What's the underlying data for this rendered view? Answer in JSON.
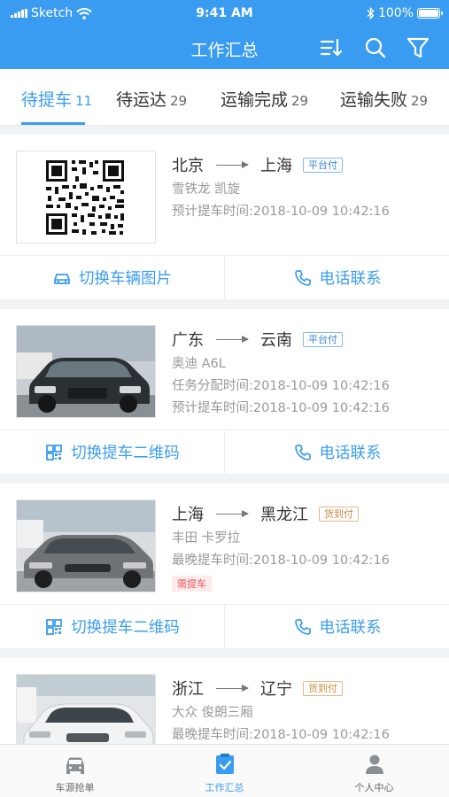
{
  "status_bar": {
    "carrier": "Sketch",
    "time": "9:41 AM",
    "battery": "100%"
  },
  "header": {
    "title": "工作汇总",
    "icons": [
      "sort-icon",
      "search-icon",
      "filter-icon"
    ]
  },
  "tabs": [
    {
      "label": "待提车",
      "count": "11",
      "active": true
    },
    {
      "label": "待运达",
      "count": "29",
      "active": false
    },
    {
      "label": "运输完成",
      "count": "29",
      "active": false
    },
    {
      "label": "运输失败",
      "count": "29",
      "active": false
    }
  ],
  "cards": [
    {
      "image": "qr-code",
      "from": "北京",
      "to": "上海",
      "pay": "平台付",
      "pay_type": "platform",
      "line1": "雪铁龙 凯旋",
      "line2": "预计提车时间:2018-10-09 10:42:16",
      "action_left": "切换车辆图片",
      "action_left_icon": "car-icon",
      "action_right": "电话联系"
    },
    {
      "image": "car-photo",
      "from": "广东",
      "to": "云南",
      "pay": "平台付",
      "pay_type": "platform",
      "line1": "奥迪 A6L",
      "line2": "任务分配时间:2018-10-09 10:42:16",
      "line3": "预计提车时间:2018-10-09 10:42:16",
      "action_left": "切换提车二维码",
      "action_left_icon": "qr-icon",
      "action_right": "电话联系"
    },
    {
      "image": "car-photo",
      "from": "上海",
      "to": "黑龙江",
      "pay": "货到付",
      "pay_type": "cod",
      "line1": "丰田 卡罗拉",
      "line2": "最晚提车时间:2018-10-09 10:42:16",
      "tag": "需提车",
      "action_left": "切换提车二维码",
      "action_left_icon": "qr-icon",
      "action_right": "电话联系"
    },
    {
      "image": "car-photo",
      "from": "浙江",
      "to": "辽宁",
      "pay": "货到付",
      "pay_type": "cod",
      "line1": "大众 俊朗三厢",
      "line2": "最晚提车时间:2018-10-09 10:42:16"
    }
  ],
  "bottom_nav": [
    {
      "label": "车源抢单",
      "icon": "car-front-icon",
      "active": false
    },
    {
      "label": "工作汇总",
      "icon": "checklist-icon",
      "active": true
    },
    {
      "label": "个人中心",
      "icon": "user-icon",
      "active": false
    }
  ],
  "colors": {
    "primary": "#3a9cf0",
    "background": "#f2f3f5",
    "cod": "#c98a3e",
    "alert": "#e05a5a"
  }
}
